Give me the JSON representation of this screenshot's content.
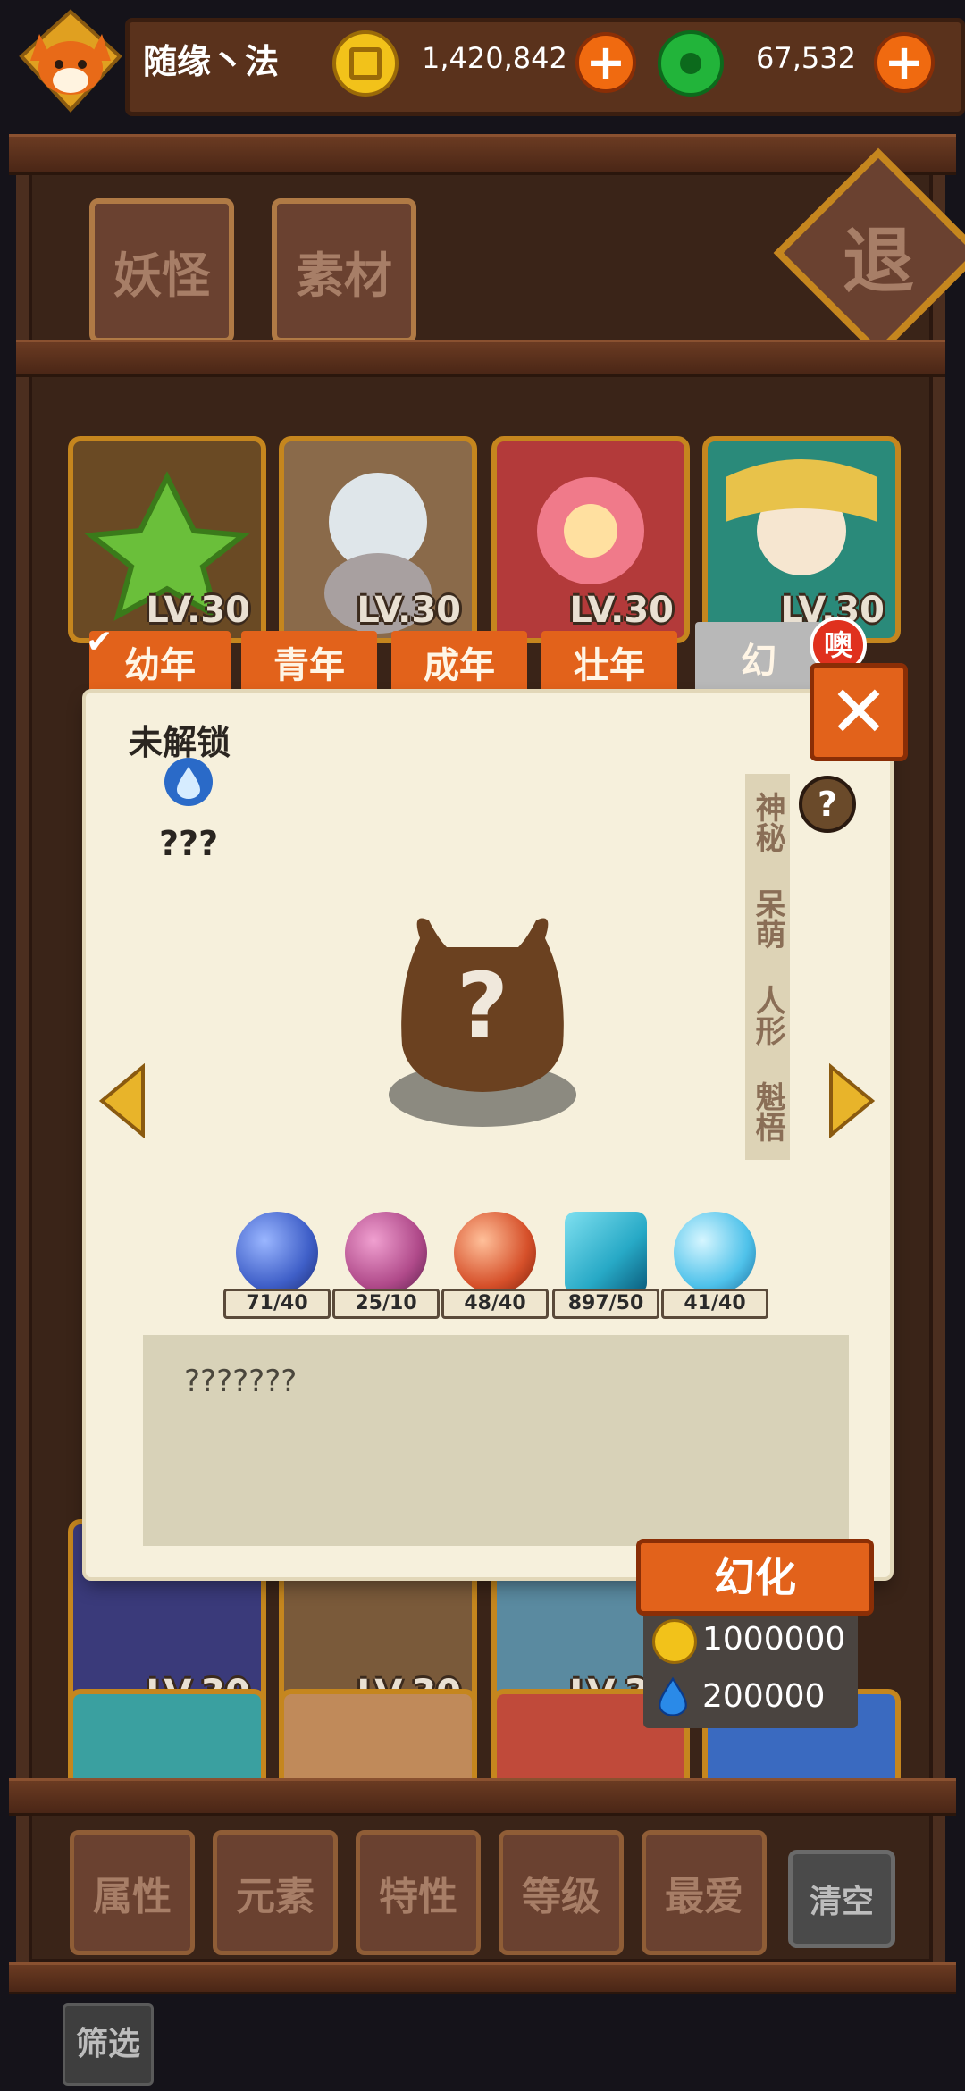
{
  "player": {
    "name": "随缘丶法",
    "gold": "1,420,842",
    "jade": "67,532"
  },
  "top_tabs": [
    "妖怪",
    "素材"
  ],
  "exit_label": "退",
  "grid_levels": [
    "LV.30",
    "LV.30",
    "LV.30",
    "LV.30",
    "LV.30",
    "LV.30",
    "LV.30"
  ],
  "age_tabs": [
    "幼年",
    "青年",
    "成年",
    "壮年",
    "幻"
  ],
  "new_badge": "噢",
  "detail": {
    "status": "未解锁",
    "name": "???",
    "traits": [
      "神秘",
      "呆萌",
      "人形",
      "魁梧"
    ],
    "description": "???????"
  },
  "resources": [
    {
      "icon": "blue-claw-orb",
      "count": "71/40",
      "color": "#3f5fc8"
    },
    {
      "icon": "purple-rune-orb",
      "count": "25/10",
      "color": "#b04a8a"
    },
    {
      "icon": "red-crab-orb",
      "count": "48/40",
      "color": "#d6502a"
    },
    {
      "icon": "cyan-wave-card",
      "count": "897/50",
      "color": "#27a9c6"
    },
    {
      "icon": "ice-crystal-orb",
      "count": "41/40",
      "color": "#4fc2ea"
    }
  ],
  "transform": {
    "label": "幻化",
    "gold_cost": "1000000",
    "water_cost": "200000"
  },
  "filters": [
    "属性",
    "元素",
    "特性",
    "等级",
    "最爱",
    "清空"
  ],
  "filter_label": "筛选",
  "colors": {
    "accent": "#e2621b",
    "wood": "#4a2616",
    "panel": "#f6f0dc"
  }
}
